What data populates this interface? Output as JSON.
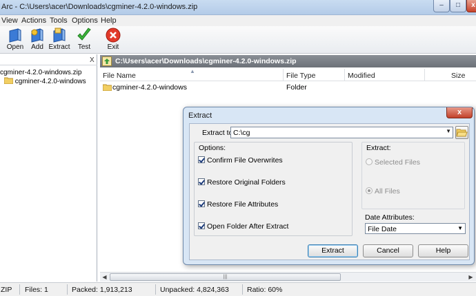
{
  "window": {
    "title": "Arc - C:\\Users\\acer\\Downloads\\cgminer-4.2.0-windows.zip",
    "controls": {
      "minimize": "–",
      "maximize": "□",
      "close": "x"
    }
  },
  "menu": [
    "View",
    "Actions",
    "Tools",
    "Options",
    "Help"
  ],
  "toolbar": {
    "open": "Open",
    "add": "Add",
    "extract": "Extract",
    "test": "Test",
    "exit": "Exit"
  },
  "tree": {
    "close_label": "X",
    "root": "cgminer-4.2.0-windows.zip",
    "child": "cgminer-4.2.0-windows"
  },
  "path_bar": {
    "path": "C:\\Users\\acer\\Downloads\\cgminer-4.2.0-windows.zip"
  },
  "file_list": {
    "columns": [
      "File Name",
      "File Type",
      "Modified",
      "Size"
    ],
    "rows": [
      {
        "name": "cgminer-4.2.0-windows",
        "type": "Folder",
        "modified": "",
        "size": ""
      }
    ]
  },
  "statusbar": {
    "format": "ZIP",
    "files": "Files: 1",
    "packed": "Packed: 1,913,213",
    "unpacked": "Unpacked: 4,824,363",
    "ratio": "Ratio: 60%"
  },
  "dialog": {
    "title": "Extract",
    "close": "x",
    "extract_to_label": "Extract to:",
    "extract_to_value": "C:\\cg",
    "options_label": "Options:",
    "options": [
      {
        "label": "Confirm File Overwrites",
        "checked": true
      },
      {
        "label": "Restore Original Folders",
        "checked": true
      },
      {
        "label": "Restore File Attributes",
        "checked": true
      },
      {
        "label": "Open Folder After Extract",
        "checked": true
      }
    ],
    "extract_label": "Extract:",
    "extract_choices": [
      {
        "label": "Selected Files",
        "selected": false
      },
      {
        "label": "All Files",
        "selected": true
      }
    ],
    "date_attr_label": "Date Attributes:",
    "date_attr_value": "File Date",
    "buttons": {
      "extract": "Extract",
      "cancel": "Cancel",
      "help": "Help"
    }
  }
}
